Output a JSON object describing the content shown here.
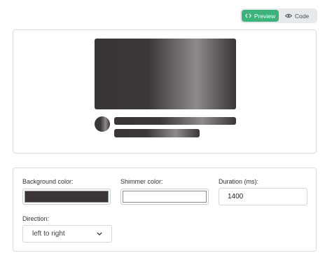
{
  "view_toggle": {
    "preview_label": "Preview",
    "code_label": "Code",
    "active": "Preview"
  },
  "preview": {
    "skeleton_color": "#3b3636",
    "shimmer_color": "#ffffff",
    "icons": [
      "code-brackets-icon",
      "eye-icon"
    ]
  },
  "controls": {
    "background_color": {
      "label": "Background color:",
      "value": "#3b3636"
    },
    "shimmer_color": {
      "label": "Shimmer color:",
      "value": "#ffffff"
    },
    "duration": {
      "label": "Duration (ms):",
      "value": "1400"
    },
    "direction": {
      "label": "Direction:",
      "selected": "left to right"
    }
  },
  "colors": {
    "accent": "#3bb37a",
    "toggle_bg": "#e6e9ec",
    "border": "#d8dde2"
  }
}
